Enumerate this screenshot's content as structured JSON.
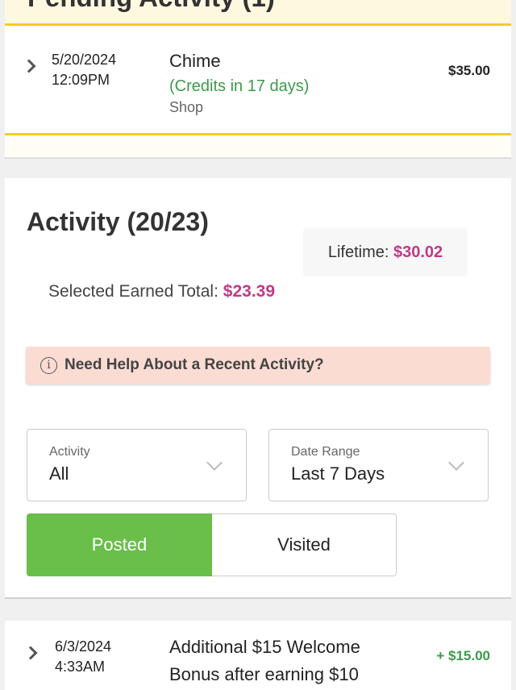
{
  "pending": {
    "title": "Pending Activity (1)",
    "transaction": {
      "date": "5/20/2024",
      "time": "12:09PM",
      "merchant": "Chime",
      "credit_note": "(Credits in 17 days)",
      "category": "Shop",
      "amount": "$35.00"
    }
  },
  "activity": {
    "title": "Activity (20/23)",
    "lifetime_label": "Lifetime:",
    "lifetime_value": "$30.02",
    "selected_label": "Selected Earned Total:",
    "selected_value": "$23.39",
    "help_text": "Need Help About a Recent Activity?",
    "filters": {
      "activity_label": "Activity",
      "activity_value": "All",
      "date_label": "Date Range",
      "date_value": "Last 7 Days"
    },
    "tabs": {
      "posted": "Posted",
      "visited": "Visited"
    }
  },
  "posted_row": {
    "date": "6/3/2024",
    "time": "4:33AM",
    "line1": "Additional $15 Welcome",
    "line2": "Bonus after earning $10",
    "amount": "+ $15.00"
  },
  "colors": {
    "accent_yellow": "#f2cf1d",
    "pink": "#c0398a",
    "green": "#6abf4b",
    "credit_green": "#3c9a4a",
    "help_bg": "#fbdcd3"
  }
}
